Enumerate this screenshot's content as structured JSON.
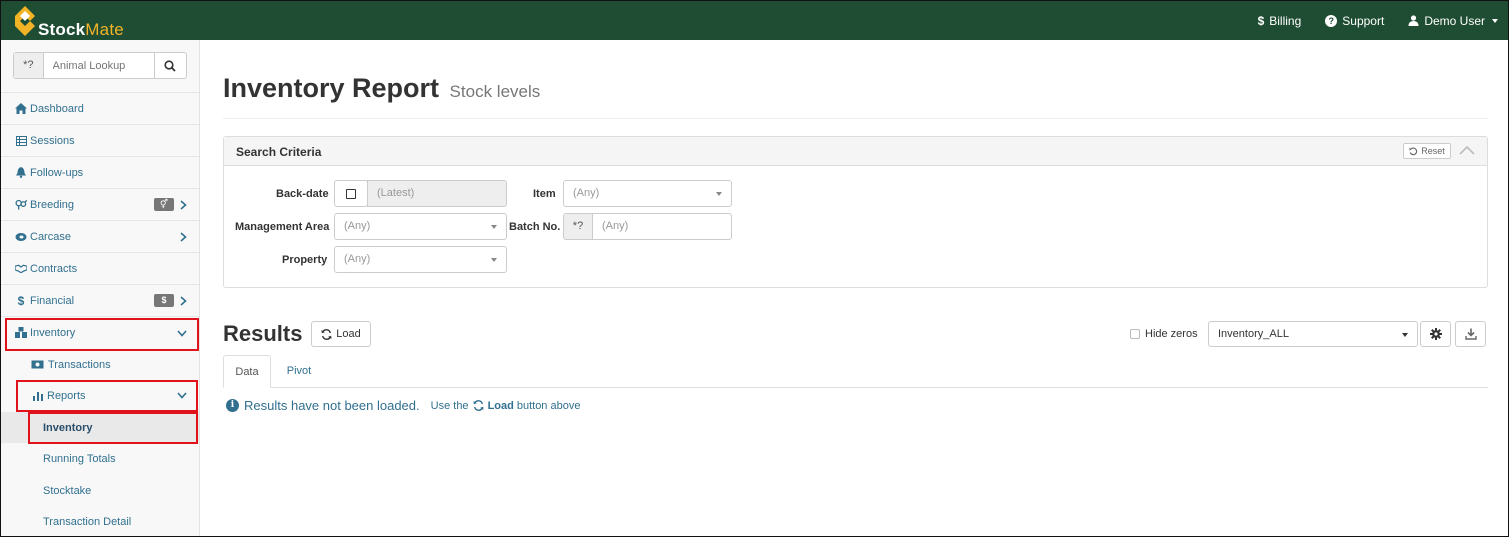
{
  "app": {
    "brand_part1": "Stock",
    "brand_part2": "Mate",
    "accent": "#1f4d33",
    "brand_color": "#f2b326"
  },
  "topnav": {
    "billing": "Billing",
    "support": "Support",
    "user": "Demo User"
  },
  "sidebar": {
    "lookup_prefix": "*?",
    "lookup_placeholder": "Animal Lookup",
    "items": [
      {
        "label": "Dashboard",
        "icon": "home-icon"
      },
      {
        "label": "Sessions",
        "icon": "table-icon"
      },
      {
        "label": "Follow-ups",
        "icon": "bell-icon"
      },
      {
        "label": "Breeding",
        "icon": "breeding-icon"
      },
      {
        "label": "Carcase",
        "icon": "carcase-icon"
      },
      {
        "label": "Contracts",
        "icon": "handshake-icon"
      },
      {
        "label": "Financial",
        "icon": "dollar-icon",
        "badge": "$"
      },
      {
        "label": "Inventory",
        "icon": "inventory-icon"
      }
    ],
    "inventory_sub": [
      {
        "label": "Transactions",
        "icon": "money-icon"
      },
      {
        "label": "Reports",
        "icon": "bar-chart-icon"
      }
    ],
    "reports_sub": [
      "Inventory",
      "Running Totals",
      "Stocktake",
      "Transaction Detail"
    ]
  },
  "page": {
    "title": "Inventory Report",
    "subtitle": "Stock levels"
  },
  "search": {
    "title": "Search Criteria",
    "reset": "Reset",
    "backdate_label": "Back-date",
    "backdate_value": "(Latest)",
    "item_label": "Item",
    "item_value": "(Any)",
    "mgmt_label": "Management Area",
    "mgmt_value": "(Any)",
    "batch_label": "Batch No.",
    "batch_prefix": "*?",
    "batch_value": "(Any)",
    "property_label": "Property",
    "property_value": "(Any)"
  },
  "results": {
    "title": "Results",
    "load": "Load",
    "hide_zeros": "Hide zeros",
    "layout_value": "Inventory_ALL",
    "tabs": [
      "Data",
      "Pivot"
    ],
    "msg_main": "Results have not been loaded.",
    "msg_use": "Use the",
    "msg_load": "Load",
    "msg_after": "button above"
  }
}
